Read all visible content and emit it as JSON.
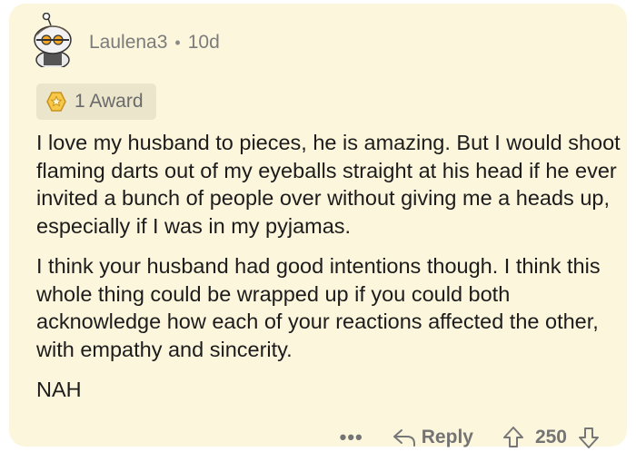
{
  "comment": {
    "username": "Laulena3",
    "separator": "•",
    "age": "10d",
    "award_label": "1 Award",
    "paragraphs": [
      "I love my husband to pieces, he is amazing. But I would shoot flaming darts out of my eyeballs straight at his head if he ever invited a bunch of people over without giving me a heads up, especially if I was in my pyjamas.",
      "I think your husband had good intentions though. I think this whole thing could be wrapped up if you could both acknowledge how each of your reactions affected the other, with empathy and sincerity.",
      "NAH"
    ]
  },
  "footer": {
    "more_label": "•••",
    "reply_label": "Reply",
    "score": "250"
  },
  "icons": {
    "avatar": "snoo-avatar",
    "award": "award-icon",
    "reply": "reply-arrow-icon",
    "upvote": "upvote-icon",
    "downvote": "downvote-icon"
  },
  "colors": {
    "card_background": "#fcf6dc",
    "award_chip": "#ebe5cc",
    "muted_text": "#7c7c7c",
    "body_text": "#1c1c1c",
    "award_gold": "#f0b429"
  }
}
